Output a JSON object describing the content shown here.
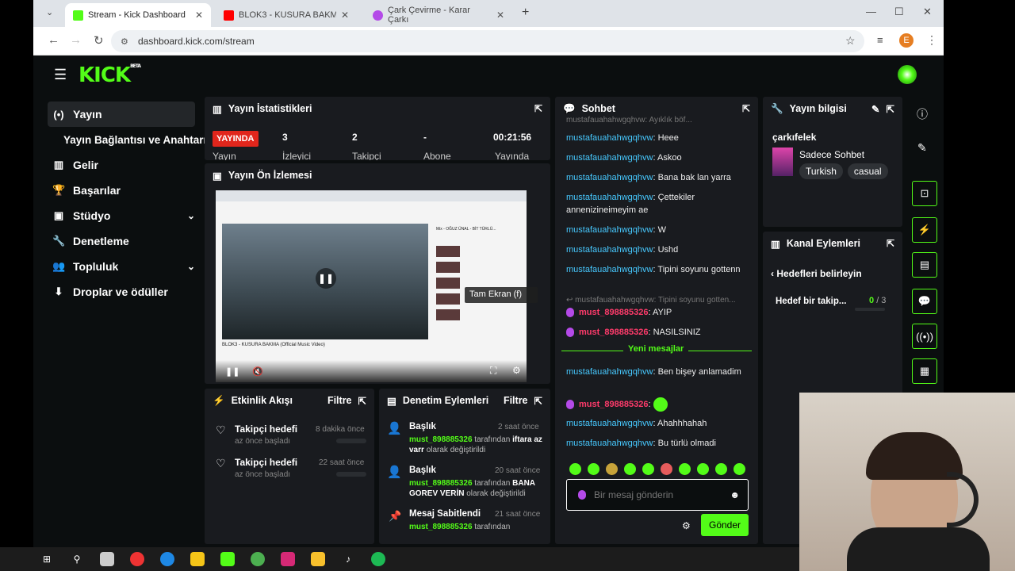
{
  "tabs": [
    {
      "label": "Stream - Kick Dashboard",
      "color": "#53fc18"
    },
    {
      "label": "BLOK3 - KUSURA BAKMA (Offici",
      "color": "#ff0000"
    },
    {
      "label": "Çark Çevirme - Karar Çarkı",
      "color": "#b44ae8"
    }
  ],
  "url": "dashboard.kick.com/stream",
  "profile_initial": "E",
  "logo": "KICK",
  "logo_beta": "BETA",
  "sidebar": [
    {
      "icon": "(•)",
      "label": "Yayın"
    },
    {
      "icon": "",
      "label": "Yayın Bağlantısı ve Anahtarı"
    },
    {
      "icon": "▥",
      "label": "Gelir"
    },
    {
      "icon": "🏆",
      "label": "Başarılar"
    },
    {
      "icon": "▣",
      "label": "Stüdyo"
    },
    {
      "icon": "🔧",
      "label": "Denetleme"
    },
    {
      "icon": "👥",
      "label": "Topluluk"
    },
    {
      "icon": "⬇",
      "label": "Droplar ve ödüller"
    }
  ],
  "stats": {
    "title": "Yayın İstatistikleri",
    "live": "YAYINDA",
    "live_sub": "Yayın",
    "items": [
      {
        "value": "3",
        "label": "İzleyici"
      },
      {
        "value": "2",
        "label": "Takipçi"
      },
      {
        "value": "-",
        "label": "Abone"
      },
      {
        "value": "00:21:56",
        "label": "Yayında"
      }
    ]
  },
  "preview": {
    "title": "Yayın Ön İzlemesi",
    "video_title": "BLOK3 - KUSURA BAKMA (Official Music Video)",
    "mix": "Mix - OĞUZ ÜNAL - BİT TÜRLÜ...",
    "fullscreen_tip": "Tam Ekran (f)"
  },
  "activity": {
    "title": "Etkinlik Akışı",
    "filter": "Filtre",
    "items": [
      {
        "title": "Takipçi hedefi",
        "sub": "az önce başladı",
        "time": "8 dakika önce"
      },
      {
        "title": "Takipçi hedefi",
        "sub": "az önce başladı",
        "time": "22 saat önce"
      }
    ]
  },
  "moderation": {
    "title": "Denetim Eylemleri",
    "filter": "Filtre",
    "items": [
      {
        "title": "Başlık",
        "time": "2 saat önce",
        "user": "must_898885326",
        "mid": "tarafından",
        "bold": "iftara az varr",
        "end": "olarak değiştirildi"
      },
      {
        "title": "Başlık",
        "time": "20 saat önce",
        "user": "must_898885326",
        "mid": "tarafından",
        "bold": "BANA GOREV VERİN",
        "end": "olarak değiştirildi"
      },
      {
        "title": "Mesaj Sabitlendi",
        "time": "21 saat önce",
        "user": "must_898885326",
        "mid": "tarafından",
        "bold": "",
        "end": ""
      }
    ]
  },
  "chat": {
    "title": "Sohbet",
    "top_cut": "mustafauahahwgqhvw: Ayıklık böf...",
    "messages": [
      {
        "user": "mustafauahahwgqhvw",
        "text": "Heee"
      },
      {
        "user": "mustafauahahwgqhvw",
        "text": "Askoo"
      },
      {
        "user": "mustafauahahwgqhvw",
        "text": "Bana bak lan yarra"
      },
      {
        "user": "mustafauahahwgqhvw",
        "text": "Çettekiler annenizineimeyim ae"
      },
      {
        "user": "mustafauahahwgqhvw",
        "text": "W"
      },
      {
        "user": "mustafauahahwgqhvw",
        "text": "Ushd"
      },
      {
        "user": "mustafauahahwgqhvw",
        "text": "Tipini soyunu gottenn"
      }
    ],
    "reply_ref": "mustafauahahwgqhvw: Tipini soyunu gotten...",
    "red_messages": [
      {
        "user": "must_898885326",
        "text": "AYIP"
      },
      {
        "user": "must_898885326",
        "text": "NASILSINIZ"
      }
    ],
    "new_label": "Yeni mesajlar",
    "after": [
      {
        "user": "mustafauahahwgqhvw",
        "text": "Ben bişey anlamadim"
      },
      {
        "user": "mustafauahahwgqhvw",
        "text": "Ahahhhahah"
      },
      {
        "user": "mustafauahahwgqhvw",
        "text": "Bu türlü olmadi"
      }
    ],
    "red_emote_user": "must_898885326",
    "placeholder": "Bir mesaj gönderin",
    "send": "Gönder"
  },
  "info": {
    "title": "Yayın bilgisi",
    "stream_title": "çarkıfelek",
    "category": "Sadece Sohbet",
    "tags": [
      "Turkish",
      "casual"
    ]
  },
  "channel": {
    "title": "Kanal Eylemleri",
    "back": "Hedefleri belirleyin",
    "goal": "Hedef bir takip...",
    "progress": "0",
    "total": "/ 3",
    "fill_fraction": 0
  }
}
